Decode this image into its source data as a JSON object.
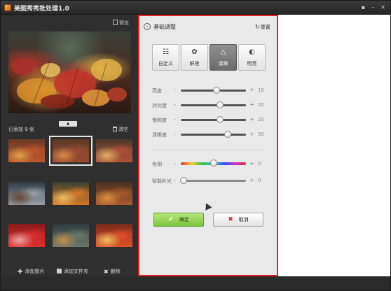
{
  "window": {
    "title": "美图秀秀批处理1.0",
    "controls": [
      "menu-icon",
      "minimize-icon",
      "close-icon"
    ]
  },
  "left_panel": {
    "preview_label": "预览",
    "added_label": "已添加 9 张",
    "clear_label": "清空",
    "thumbnails": [
      {
        "colors": [
          "#6a3a26",
          "#c0562e",
          "#e2a04a"
        ]
      },
      {
        "colors": [
          "#5a3a28",
          "#9c4a32",
          "#d88a48"
        ],
        "selected": true
      },
      {
        "colors": [
          "#4a3a2a",
          "#b4523a",
          "#e0b064"
        ]
      },
      {
        "colors": [
          "#2f3a44",
          "#9aa0a8",
          "#6a4a3a"
        ]
      },
      {
        "colors": [
          "#3a4030",
          "#d8782a",
          "#f0c060"
        ]
      },
      {
        "colors": [
          "#4a3020",
          "#a85a2e",
          "#e0903a"
        ]
      },
      {
        "colors": [
          "#8a1a1a",
          "#e03030",
          "#f0a0a0"
        ]
      },
      {
        "colors": [
          "#2e3a40",
          "#6a7a68",
          "#c09050"
        ]
      },
      {
        "colors": [
          "#7a2a1a",
          "#e0502a",
          "#f0c060"
        ]
      }
    ],
    "add_image_label": "添加图片",
    "add_folder_label": "添加文件夹",
    "delete_label": "删除"
  },
  "adjust_panel": {
    "title": "基础调整",
    "reset_label": "重置",
    "modes": [
      {
        "label": "自定义",
        "icon": "sliders-icon",
        "glyph": "☷",
        "active": false
      },
      {
        "label": "鲜艳",
        "icon": "flower-icon",
        "glyph": "✿",
        "active": false
      },
      {
        "label": "清晰",
        "icon": "triangle-icon",
        "glyph": "△",
        "active": true
      },
      {
        "label": "明亮",
        "icon": "contrast-icon",
        "glyph": "◐",
        "active": false
      }
    ],
    "sliders": [
      {
        "label": "亮度",
        "value": "10",
        "level": 0.55,
        "style": "dark"
      },
      {
        "label": "对比度",
        "value": "20",
        "level": 0.6,
        "style": "dark"
      },
      {
        "label": "饱和度",
        "value": "20",
        "level": 0.6,
        "style": "dark"
      },
      {
        "label": "清晰度",
        "value": "50",
        "level": 0.72,
        "style": "dark"
      },
      {
        "label": "色相",
        "value": "0",
        "level": 0.5,
        "style": "hue"
      },
      {
        "label": "智能补光",
        "value": "0",
        "level": 0.04,
        "style": "light"
      }
    ],
    "ok_label": "确定",
    "cancel_label": "取消"
  },
  "colors": {
    "highlight_border": "#e0202a",
    "ok_button": "#8fd048",
    "cancel_icon": "#d42a2a"
  }
}
